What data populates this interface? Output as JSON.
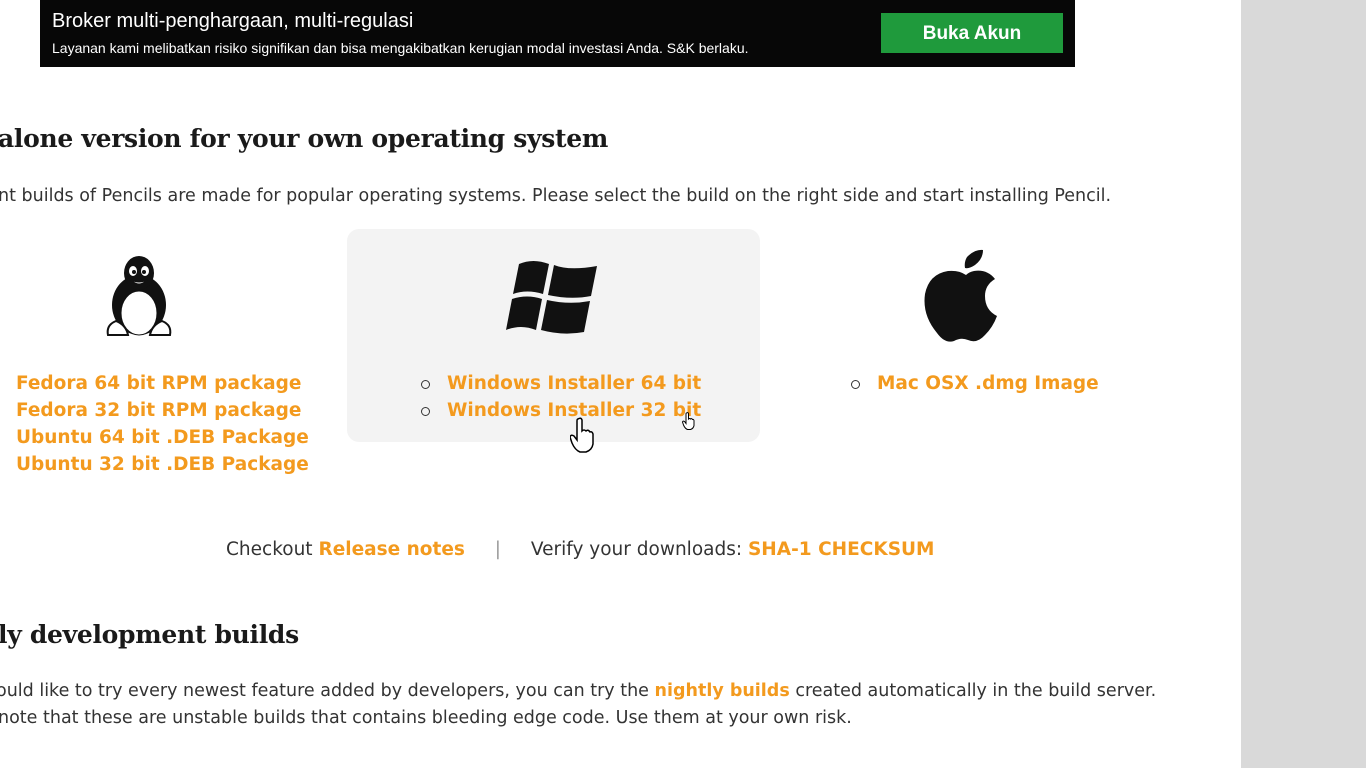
{
  "ad": {
    "title": "Broker multi-penghargaan, multi-regulasi",
    "subtitle": "Layanan kami melibatkan risiko signifikan dan bisa mengakibatkan kerugian modal investasi Anda. S&K berlaku.",
    "button_label": "Buka Akun",
    "button_color": "#1f9a3c"
  },
  "standalone": {
    "heading": "alone version for your own operating system",
    "description": "nt builds of Pencils are made for popular operating systems. Please select the build on the right side and start installing Pencil."
  },
  "linux": {
    "icon": "linux-penguin-icon",
    "items": [
      "Fedora 64 bit RPM package",
      "Fedora 32 bit RPM package",
      "Ubuntu 64 bit .DEB Package",
      "Ubuntu 32 bit .DEB Package"
    ]
  },
  "windows": {
    "icon": "windows-logo-icon",
    "items": [
      "Windows Installer 64 bit",
      "Windows Installer 32 bit"
    ]
  },
  "mac": {
    "icon": "apple-logo-icon",
    "items": [
      "Mac OSX .dmg Image"
    ]
  },
  "footer_links": {
    "checkout_text": "Checkout",
    "release_notes": "Release notes",
    "separator": "|",
    "verify_text": "Verify your downloads:",
    "checksum": "SHA-1 CHECKSUM"
  },
  "nightly": {
    "heading": "ly development builds",
    "line1_before": "ould like to try every newest feature added by developers, you can try the",
    "line1_link": "nightly builds",
    "line1_after": "created automatically in the build server.",
    "line2": "note that these are unstable builds that contains bleeding edge code. Use them at your own risk."
  },
  "colors": {
    "link": "#f39a1e",
    "highlight_box": "#f3f3f3"
  }
}
